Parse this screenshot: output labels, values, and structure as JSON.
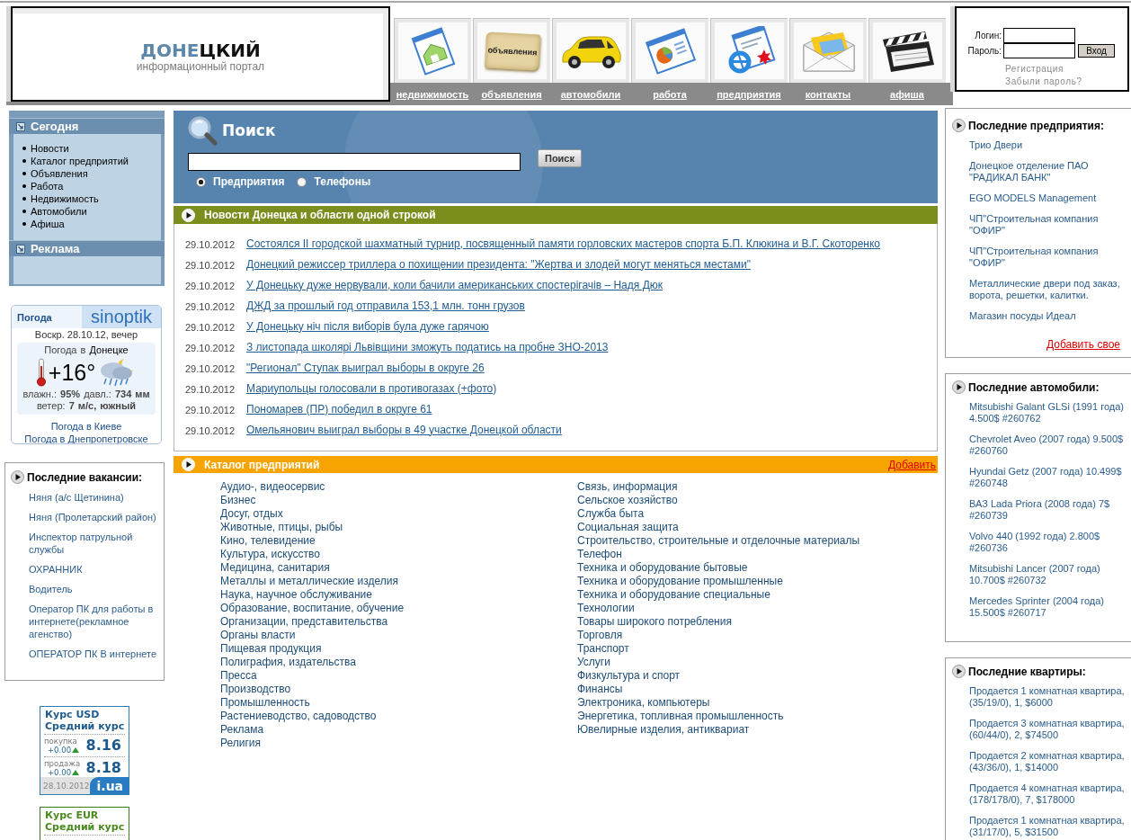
{
  "header": {
    "logo": {
      "title_accent": "ДОНЕ",
      "title_rest": "ЦКИЙ",
      "tagline": "информационный портал"
    },
    "nav": [
      {
        "kind": "house",
        "label": "недвижимость"
      },
      {
        "kind": "scroll",
        "label": "объявления",
        "icon_text": "объявления"
      },
      {
        "kind": "car",
        "label": "автомобили"
      },
      {
        "kind": "chart",
        "label": "работа"
      },
      {
        "kind": "web",
        "label": "предприятия"
      },
      {
        "kind": "mail",
        "label": "контакты"
      },
      {
        "kind": "clapper",
        "label": "афиша"
      }
    ],
    "login": {
      "login_label": "Логин:",
      "password_label": "Пароль:",
      "submit": "Вход",
      "links": [
        "Регистрация",
        "Забыли пароль?"
      ]
    }
  },
  "left": {
    "menu": {
      "title": "Сегодня",
      "items": [
        "Новости",
        "Каталог предприятий",
        "Объявления",
        "Работа",
        "Недвижимость",
        "Автомобили",
        "Афиша"
      ]
    },
    "ads": {
      "title": "Реклама"
    },
    "weather": {
      "title": "Погода",
      "brand": "sinoptik",
      "date": "Воскр. 28.10.12, вечер",
      "place_prefix": "Погода в",
      "place": "Донецке",
      "temperature": "+16°",
      "humidity_pressure": "влажн.: **95%** давл.: **734 мм**",
      "wind": "ветер: **7 м/с, южный**",
      "links": [
        "Погода в Киеве",
        "Погода в Днепропетровске"
      ]
    },
    "vacancies": {
      "title": "Последние вакансии:",
      "items": [
        "Няня (а/с Щетинина)",
        "Няня (Пролетарский район)",
        "Инспектор патрульной службы",
        "ОХРАННИК",
        "Водитель",
        "Оператор ПК для работы в интернете(рекламное агенство)",
        "ОПЕРАТОР ПК В интернете"
      ]
    },
    "rates": [
      {
        "kind": "usd",
        "title": "Курс USD",
        "subtitle": "Средний курс",
        "rows": [
          {
            "label": "покупка",
            "change": "+0.00",
            "value": "8.16"
          },
          {
            "label": "продажа",
            "change": "+0.00",
            "value": "8.18"
          }
        ],
        "date": "28.10.2012",
        "brand": "i.ua"
      },
      {
        "kind": "eur",
        "title": "Курс EUR",
        "subtitle": "Средний курс"
      }
    ]
  },
  "search": {
    "title": "Поиск",
    "button": "Поиск",
    "options": [
      {
        "label": "Предприятия",
        "selected": true
      },
      {
        "label": "Телефоны",
        "selected": false
      }
    ]
  },
  "news": {
    "title": "Новости Донецка и области одной строкой",
    "items": [
      {
        "date": "29.10.2012",
        "title": "Состоялся II городской шахматный турнир, посвященный памяти горловских мастеров спорта Б.П. Клюкина и В.Г. Скоторенко"
      },
      {
        "date": "29.10.2012",
        "title": "Донецкий режиссер триллера о похищении президента: \"Жертва и злодей могут меняться местами\""
      },
      {
        "date": "29.10.2012",
        "title": "У Донецьку дуже нервували, коли бачили американських спостерігачів – Надя Дюк"
      },
      {
        "date": "29.10.2012",
        "title": "ДЖД за прошлый год отправила 153,1 млн. тонн грузов"
      },
      {
        "date": "29.10.2012",
        "title": "У Донецьку ніч після виборів була дуже гарячою"
      },
      {
        "date": "29.10.2012",
        "title": "З листопада школярі Львівщини зможуть податись на пробне ЗНО-2013"
      },
      {
        "date": "29.10.2012",
        "title": "\"Регионал\" Ступак выиграл выборы в округе 26"
      },
      {
        "date": "29.10.2012",
        "title": "Мариупольцы голосовали в противогазах (+фото)"
      },
      {
        "date": "29.10.2012",
        "title": "Пономарев (ПР) победил в округе 61"
      },
      {
        "date": "29.10.2012",
        "title": "Омельянович выиграл выборы в 49 участке Донецкой области"
      }
    ]
  },
  "catalog": {
    "title": "Каталог предприятий",
    "add_link": "Добавить",
    "columns": [
      [
        "Аудио-, видеосервис",
        "Бизнес",
        "Досуг, отдых",
        "Животные, птицы, рыбы",
        "Кино, телевидение",
        "Культура, искусство",
        "Медицина, санитария",
        "Металлы и металлические изделия",
        "Наука, научное обслуживание",
        "Образование, воспитание, обучение",
        "Организации, представительства",
        "Органы власти",
        "Пищевая продукция",
        "Полиграфия, издательства",
        "Пресса",
        "Производство",
        "Промышленность",
        "Растениеводство, садоводство",
        "Реклама",
        "Религия"
      ],
      [
        "Связь, информация",
        "Сельское хозяйство",
        "Служба быта",
        "Социальная защита",
        "Строительство, строительные и отделочные материалы",
        "Телефон",
        "Техника и оборудование бытовые",
        "Техника и оборудование промышленные",
        "Техника и оборудование специальные",
        "Технологии",
        "Товары широкого потребления",
        "Торговля",
        "Транспорт",
        "Услуги",
        "Физкультура и спорт",
        "Финансы",
        "Электроника, компьютеры",
        "Энергетика, топливная промышленность",
        "Ювелирные изделия, антиквариат"
      ]
    ]
  },
  "right": [
    {
      "title": "Последние предприятия:",
      "items": [
        "Трио Двери",
        "Донецкое отделение ПАО \"РАДИКАЛ БАНК\"",
        "EGO MODELS Management",
        "ЧП\"Строительная компания \"ОФИР\"",
        "ЧП\"Строительная компания \"ОФИР\"",
        "Металлические двери под заказ, ворота, решетки, калитки.",
        "Магазин посуды Идеал"
      ],
      "add_link": "Добавить свое"
    },
    {
      "title": "Последние автомобили:",
      "items": [
        "Mitsubishi Galant GLSi (1991 года) 4.500$ #260762",
        "Chevrolet Aveo (2007 года) 9.500$ #260760",
        "Hyundai Getz (2007 года) 10.499$ #260748",
        "ВАЗ Lada Priora (2008 года) 7$ #260739",
        "Volvo 440 (1992 года) 2.800$ #260736",
        "Mitsubishi Lancer (2007 года) 10.700$ #260732",
        "Mercedes Sprinter (2004 года) 15.500$ #260717"
      ]
    },
    {
      "title": "Последние квартиры:",
      "items": [
        "Продается 1 комнатная квартира, (35/19/0), 1, $6000",
        "Продается 3 комнатная квартира, (60/44/0), 2, $74500",
        "Продается 2 комнатная квартира, (43/36/0), 1, $14000",
        "Продается 4 комнатная квартира, (178/178/0), 7, $178000",
        "Продается 1 комнатная квартира, (31/17/0), 5, $31500"
      ]
    }
  ]
}
